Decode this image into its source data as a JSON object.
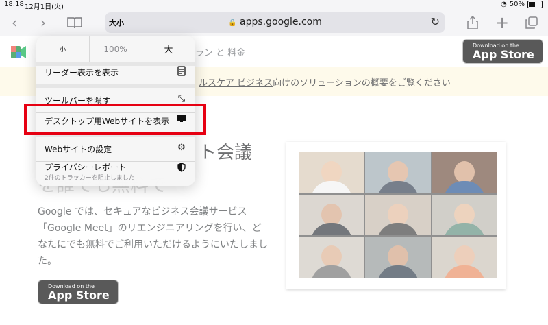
{
  "status_bar": {
    "time": "18:18",
    "date": "12月1日(火)",
    "battery": "50%"
  },
  "toolbar": {
    "back_icon": "chevron-left-icon",
    "forward_icon": "chevron-right-icon",
    "bookmarks_icon": "book-icon",
    "aa_label": "大小",
    "url": "apps.google.com",
    "reload_icon": "reload-icon",
    "share_icon": "share-icon",
    "new_tab_icon": "plus-icon",
    "tabs_icon": "tabs-icon"
  },
  "page": {
    "nav_fragment": "ラン と 料金",
    "store_top": {
      "small": "Download on the",
      "big": "App Store"
    },
    "banner": {
      "link_fragment": "ルスケア ビジネス",
      "rest": "向けのソリューションの概要をご覧ください"
    },
    "hero_fragment": "ト会議",
    "hero_sub_fragment": "を誰でも無料で",
    "body_text": "Google では、セキュアなビジネス会議サービス「Google Meet」のリエンジニアリングを行い、どなたにでも無料でご利用いただけるようにいたしました。",
    "store_bottom": {
      "small": "Download on the",
      "big": "App Store"
    }
  },
  "menu": {
    "zoom_small": "小",
    "zoom_percent": "100%",
    "zoom_big": "大",
    "items": [
      {
        "label": "リーダー表示を表示",
        "icon": "reader-icon"
      },
      {
        "label": "ツールバーを隠す",
        "icon": "arrows-diagonal-icon"
      },
      {
        "label": "デスクトップ用Webサイトを表示",
        "icon": "desktop-icon"
      },
      {
        "label": "Webサイトの設定",
        "icon": "gear-icon"
      },
      {
        "label": "プライバシーレポート",
        "sub": "2件のトラッカーを阻止しました",
        "icon": "shield-icon"
      }
    ]
  },
  "colors": {
    "highlight": "#e60012",
    "banner_bg": "#fef7e0"
  }
}
